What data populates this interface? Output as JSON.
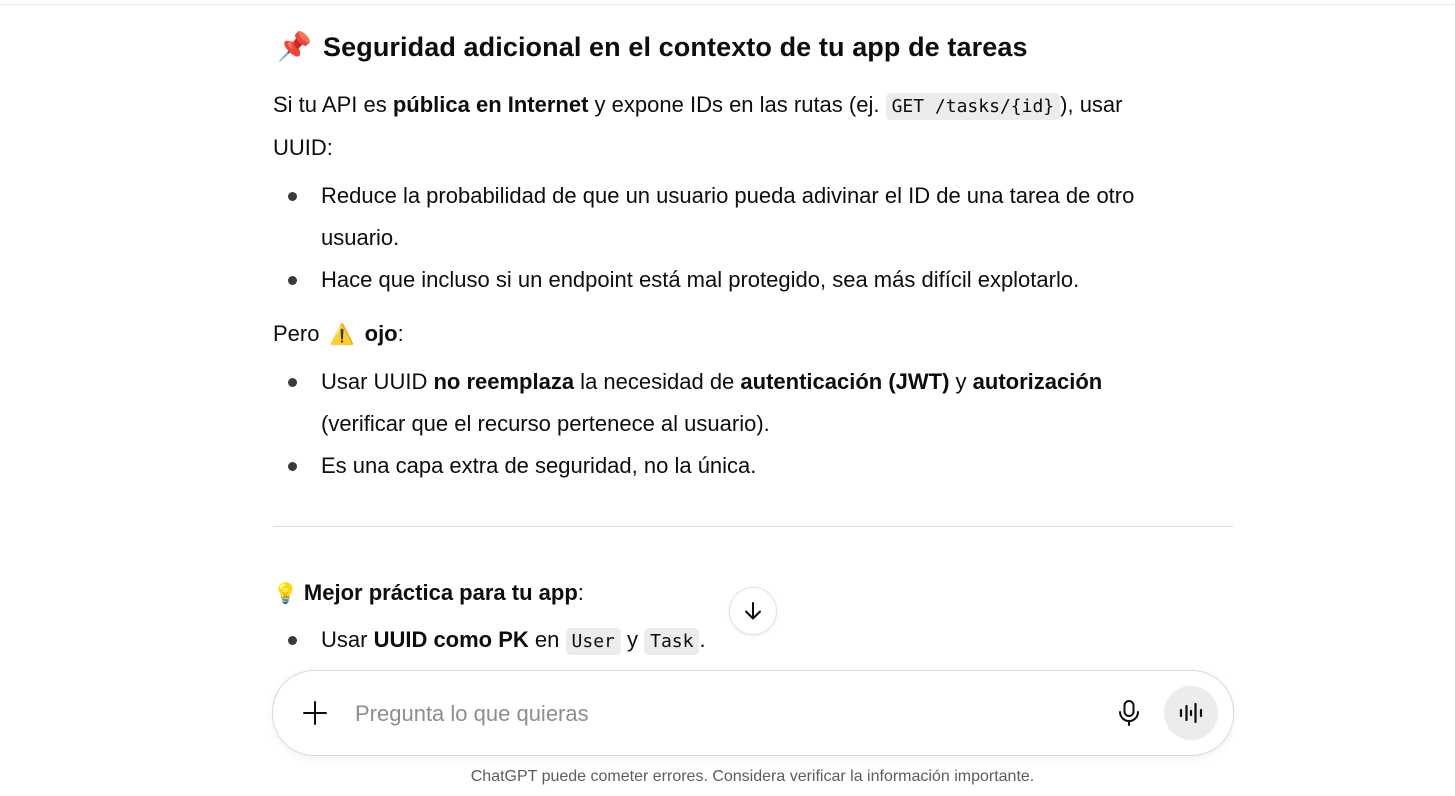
{
  "heading": {
    "emoji": "📌",
    "text": "Seguridad adicional en el contexto de tu app de tareas"
  },
  "intro": {
    "part1": "Si tu API es ",
    "bold1": "pública en Internet",
    "part2": " y expone IDs en las rutas (ej. ",
    "code1": "GET /tasks/{id}",
    "part3": "), usar",
    "line2": "UUID:"
  },
  "bullets_a": [
    {
      "line1": "Reduce la probabilidad de que un usuario pueda adivinar el ID de una tarea de otro",
      "line2": "usuario."
    },
    {
      "line1": "Hace que incluso si un endpoint está mal protegido, sea más difícil explotarlo."
    }
  ],
  "caveat": {
    "prefix": "Pero ",
    "emoji": "⚠️",
    "bold": "ojo",
    "suffix": ":"
  },
  "bullets_b": {
    "item1": {
      "t1": "Usar UUID ",
      "b1": "no reemplaza",
      "t2": " la necesidad de ",
      "b2": "autenticación (JWT)",
      "t3": " y ",
      "b3": "autorización",
      "line2": "(verificar que el recurso pertenece al usuario)."
    },
    "item2": "Es una capa extra de seguridad, no la única."
  },
  "best_practice": {
    "emoji": "💡",
    "bold": "Mejor práctica para tu app",
    "suffix": ":",
    "item1": {
      "t1": "Usar ",
      "b1": "UUID como PK",
      "t2": " en ",
      "code1": "User",
      "t3": " y ",
      "code2": "Task",
      "t4": "."
    }
  },
  "composer": {
    "placeholder": "Pregunta lo que quieras",
    "value": ""
  },
  "icons": {
    "scroll": "arrow-down-icon",
    "attach": "plus-icon",
    "mic": "microphone-icon",
    "voice": "voice-mode-icon"
  },
  "disclaimer": "ChatGPT puede cometer errores. Considera verificar la información importante."
}
